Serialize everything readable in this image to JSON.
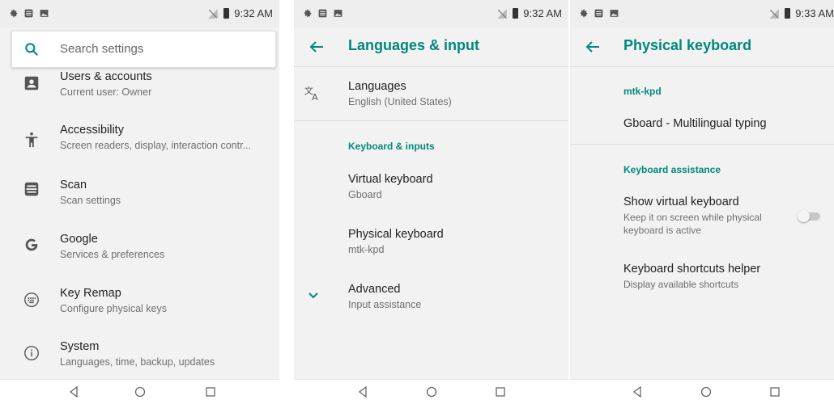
{
  "status": {
    "time_1": "9:32 AM",
    "time_2": "9:32 AM",
    "time_3": "9:33 AM"
  },
  "screen1": {
    "search_placeholder": "Search settings",
    "items": [
      {
        "title": "Users & accounts",
        "subtitle": "Current user: Owner",
        "icon": "account-box-icon"
      },
      {
        "title": "Accessibility",
        "subtitle": "Screen readers, display, interaction contr...",
        "icon": "accessibility-icon"
      },
      {
        "title": "Scan",
        "subtitle": "Scan settings",
        "icon": "scan-icon"
      },
      {
        "title": "Google",
        "subtitle": "Services & preferences",
        "icon": "google-icon"
      },
      {
        "title": "Key Remap",
        "subtitle": "Configure physical keys",
        "icon": "keyboard-icon"
      },
      {
        "title": "System",
        "subtitle": "Languages, time, backup, updates",
        "icon": "info-icon"
      }
    ]
  },
  "screen2": {
    "title": "Languages & input",
    "languages": {
      "title": "Languages",
      "subtitle": "English (United States)"
    },
    "category": "Keyboard & inputs",
    "virtual_keyboard": {
      "title": "Virtual keyboard",
      "subtitle": "Gboard"
    },
    "physical_keyboard": {
      "title": "Physical keyboard",
      "subtitle": "mtk-kpd"
    },
    "advanced": {
      "title": "Advanced",
      "subtitle": "Input assistance"
    }
  },
  "screen3": {
    "title": "Physical keyboard",
    "device_header": "mtk-kpd",
    "gboard": "Gboard - Multilingual typing",
    "category": "Keyboard assistance",
    "show_virtual": {
      "title": "Show virtual keyboard",
      "subtitle_line1": "Keep it on screen while physical",
      "subtitle_line2": "keyboard is active",
      "enabled": false
    },
    "shortcuts": {
      "title": "Keyboard shortcuts helper",
      "subtitle": "Display available shortcuts"
    }
  },
  "colors": {
    "accent": "#00897b",
    "background": "#f2f2f2"
  }
}
